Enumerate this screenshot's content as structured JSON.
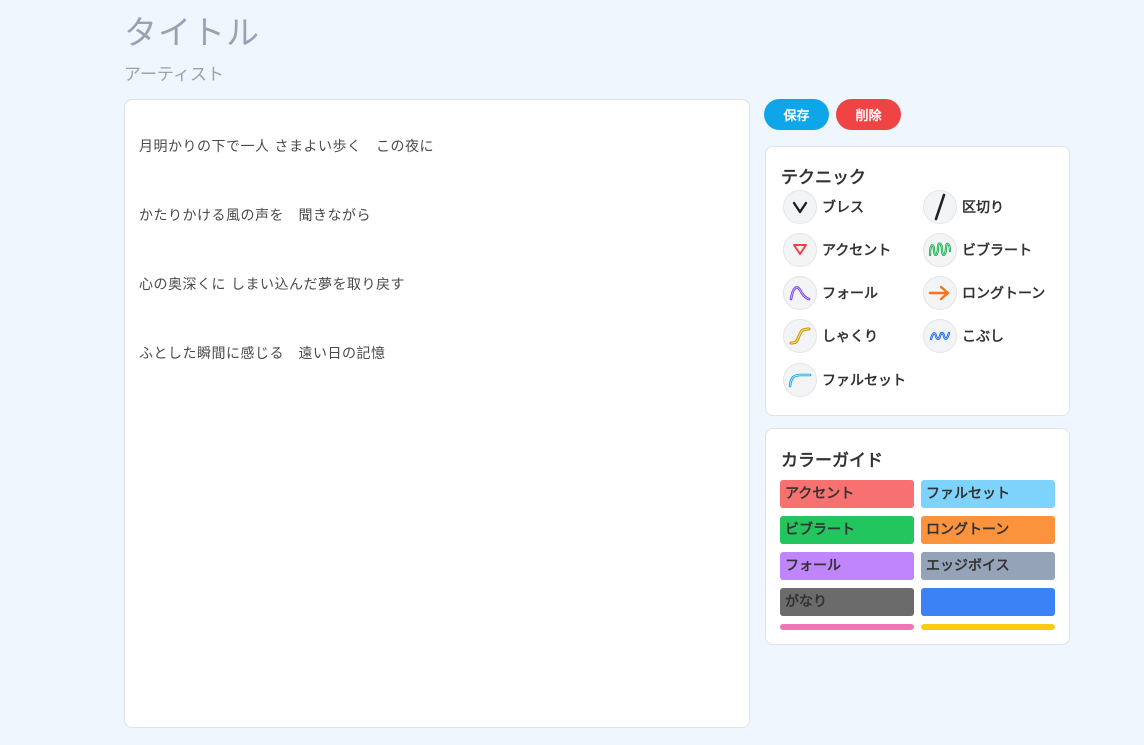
{
  "song": {
    "title": "タイトル",
    "artist": "アーティスト"
  },
  "lyrics": [
    "月明かりの下で一人 さまよい歩く　この夜に",
    "かたりかける風の声を　聞きながら",
    "心の奥深くに しまい込んだ夢を取り戻す",
    "ふとした瞬間に感じる　遠い日の記憶"
  ],
  "actions": {
    "save_label": "保存",
    "delete_label": "削除",
    "save_color": "#0ea5e9",
    "delete_color": "#ef4444"
  },
  "techniques": {
    "title": "テクニック",
    "items": [
      {
        "label": "ブレス",
        "icon": "breath-icon"
      },
      {
        "label": "区切り",
        "icon": "separator-icon"
      },
      {
        "label": "アクセント",
        "icon": "accent-icon"
      },
      {
        "label": "ビブラート",
        "icon": "vibrato-icon"
      },
      {
        "label": "フォール",
        "icon": "fall-icon"
      },
      {
        "label": "ロングトーン",
        "icon": "long-tone-icon"
      },
      {
        "label": "しゃくり",
        "icon": "shakuri-icon"
      },
      {
        "label": "こぶし",
        "icon": "kobushi-icon"
      },
      {
        "label": "ファルセット",
        "icon": "falsetto-icon"
      }
    ]
  },
  "color_guide": {
    "title": "カラーガイド",
    "items": [
      {
        "label": "アクセント",
        "color": "#f87171"
      },
      {
        "label": "ファルセット",
        "color": "#7dd3fc"
      },
      {
        "label": "ビブラート",
        "color": "#22c55e"
      },
      {
        "label": "ロングトーン",
        "color": "#fb923c"
      },
      {
        "label": "フォール",
        "color": "#c084fc"
      },
      {
        "label": "エッジボイス",
        "color": "#94a3b8"
      },
      {
        "label": "がなり",
        "color": "#6b6b6b"
      },
      {
        "label": "",
        "color": "#3b82f6"
      }
    ],
    "bars": [
      {
        "color": "#f472b6"
      },
      {
        "color": "#facc15"
      }
    ]
  }
}
